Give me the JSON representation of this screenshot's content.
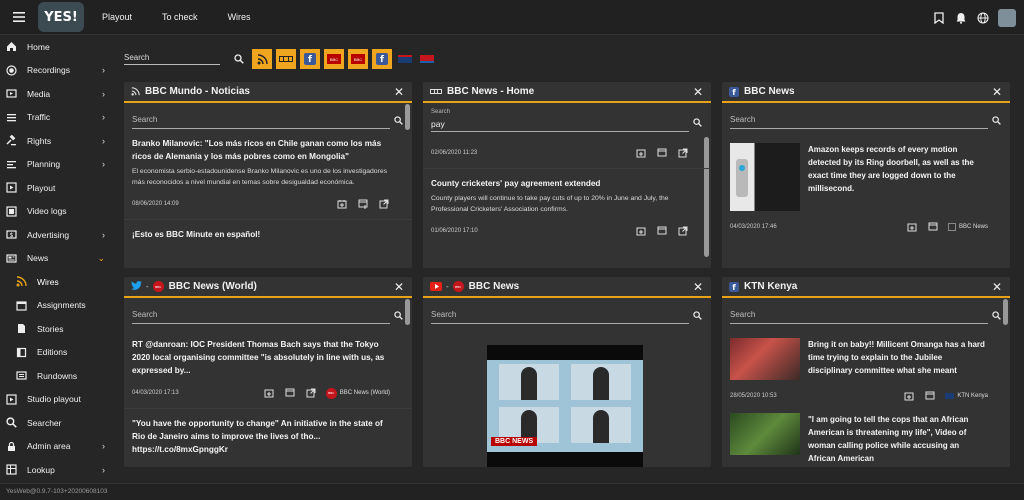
{
  "topbar": {
    "logo_text": "YES!",
    "nav": [
      "Playout",
      "To check",
      "Wires"
    ]
  },
  "sidebar": {
    "items": [
      {
        "label": "Home",
        "icon": "home-icon",
        "chevron": false
      },
      {
        "label": "Recordings",
        "icon": "record-icon",
        "chevron": true
      },
      {
        "label": "Media",
        "icon": "media-icon",
        "chevron": true
      },
      {
        "label": "Traffic",
        "icon": "list-icon",
        "chevron": true
      },
      {
        "label": "Rights",
        "icon": "gavel-icon",
        "chevron": true
      },
      {
        "label": "Planning",
        "icon": "planning-icon",
        "chevron": true
      },
      {
        "label": "Playout",
        "icon": "play-icon",
        "chevron": false
      },
      {
        "label": "Video logs",
        "icon": "video-log-icon",
        "chevron": false
      },
      {
        "label": "Advertising",
        "icon": "dollar-icon",
        "chevron": true
      },
      {
        "label": "News",
        "icon": "news-icon",
        "chevron": true
      },
      {
        "label": "Wires",
        "icon": "rss-icon",
        "chevron": false
      },
      {
        "label": "Assignments",
        "icon": "calendar-icon",
        "chevron": false
      },
      {
        "label": "Stories",
        "icon": "document-icon",
        "chevron": false
      },
      {
        "label": "Editions",
        "icon": "book-icon",
        "chevron": false
      },
      {
        "label": "Rundowns",
        "icon": "rundown-icon",
        "chevron": false
      },
      {
        "label": "Studio playout",
        "icon": "play-icon",
        "chevron": false
      },
      {
        "label": "Searcher",
        "icon": "search-icon",
        "chevron": false
      },
      {
        "label": "Admin area",
        "icon": "lock-icon",
        "chevron": true
      },
      {
        "label": "Lookup",
        "icon": "lookup-icon",
        "chevron": true
      }
    ]
  },
  "footer": {
    "version": "YesWeb@0.9.7-103+20200608103"
  },
  "toolbar": {
    "search_placeholder": "Search"
  },
  "cards": [
    {
      "title": "BBC Mundo - Noticias",
      "search_placeholder": "Search",
      "items": [
        {
          "title": "Branko Milanovic: \"Los más ricos en Chile ganan como los más ricos de Alemania y los más pobres como en Mongolia\"",
          "text": "El economista serbio-estadounidense Branko Milanovic es uno de los investigadores más reconocidos a nivel mundial en temas sobre desigualdad económica.",
          "date": "08/06/2020 14:09"
        },
        {
          "title": "¡Esto es BBC Minute en español!"
        }
      ]
    },
    {
      "title": "BBC News - Home",
      "search_label": "Search",
      "search_value": "pay",
      "items": [
        {
          "date": "02/06/2020 11:23"
        },
        {
          "title": "County cricketers' pay agreement extended",
          "text": "County players will continue to take pay cuts of up to 20% in June and July, the Professional Cricketers' Association confirms.",
          "date": "01/06/2020 17:10"
        }
      ]
    },
    {
      "title": "BBC News",
      "search_placeholder": "Search",
      "items": [
        {
          "title": "Amazon keeps records of every motion detected by its Ring doorbell, as well as the exact time they are logged down to the millisecond.",
          "date": "04/03/2020 17:46",
          "source": "BBC News"
        }
      ]
    },
    {
      "title": "BBC News (World)",
      "search_placeholder": "Search",
      "items": [
        {
          "title": "RT @danroan: IOC President Thomas Bach says that the Tokyo 2020 local organising committee \"is absolutely in line with us, as expressed by...",
          "date": "04/03/2020 17:13",
          "source": "BBC News (World)"
        },
        {
          "title": "\"You have the opportunity to change\" An initiative in the state of Rio de Janeiro aims to improve the lives of tho... https://t.co/8mxGpnggKr"
        }
      ]
    },
    {
      "title": "BBC News",
      "search_placeholder": "Search",
      "image_caption": "BBC NEWS"
    },
    {
      "title": "KTN Kenya",
      "search_placeholder": "Search",
      "items": [
        {
          "title": "Bring it on baby!! Millicent Omanga has a hard time trying to explain to the Jubilee disciplinary committee what she meant",
          "date": "28/05/2020 10:53",
          "source": "KTN Kenya"
        },
        {
          "title": "\"I am going to tell the cops that an African American is threatening my life\", Video of woman calling police while accusing an African American"
        }
      ]
    }
  ],
  "colors": {
    "accent": "#e8a317",
    "background": "#262626",
    "card": "#333333"
  }
}
